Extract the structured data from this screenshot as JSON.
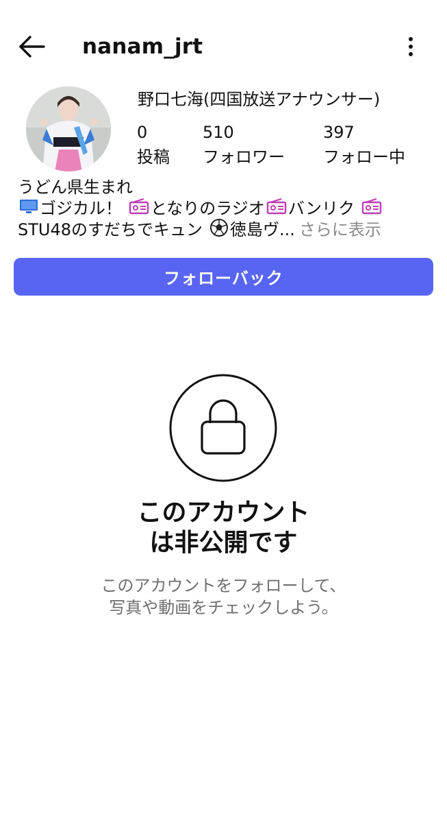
{
  "header": {
    "username": "nanam_jrt",
    "back_icon": "arrow-left-icon",
    "more_icon": "more-vertical-icon"
  },
  "profile": {
    "display_name": "野口七海(四国放送アナウンサー)",
    "stats": {
      "posts": {
        "count": "0",
        "label": "投稿"
      },
      "followers": {
        "count": "510",
        "label": "フォロワー"
      },
      "following": {
        "count": "397",
        "label": "フォロー中"
      }
    },
    "bio": {
      "line1": "うどん県生まれ",
      "line2_a": "ゴジカル！",
      "line2_b": "となりのラジオ",
      "line2_c": "バンリク",
      "line3_a": "STU48のすだちでキュン",
      "line3_b": "徳島ヴ...",
      "more_label": "さらに表示"
    }
  },
  "actions": {
    "follow_back_label": "フォローバック"
  },
  "private_notice": {
    "title_line1": "このアカウント",
    "title_line2": "は非公開です",
    "subtitle_line1": "このアカウントをフォローして、",
    "subtitle_line2": "写真や動画をチェックしよう。",
    "icon": "lock-icon"
  },
  "colors": {
    "accent": "#5865f2",
    "text": "#111111",
    "muted": "#6f6f6f",
    "radio_emoji": "#c03ab5",
    "tv_emoji": "#2f6bd6"
  }
}
